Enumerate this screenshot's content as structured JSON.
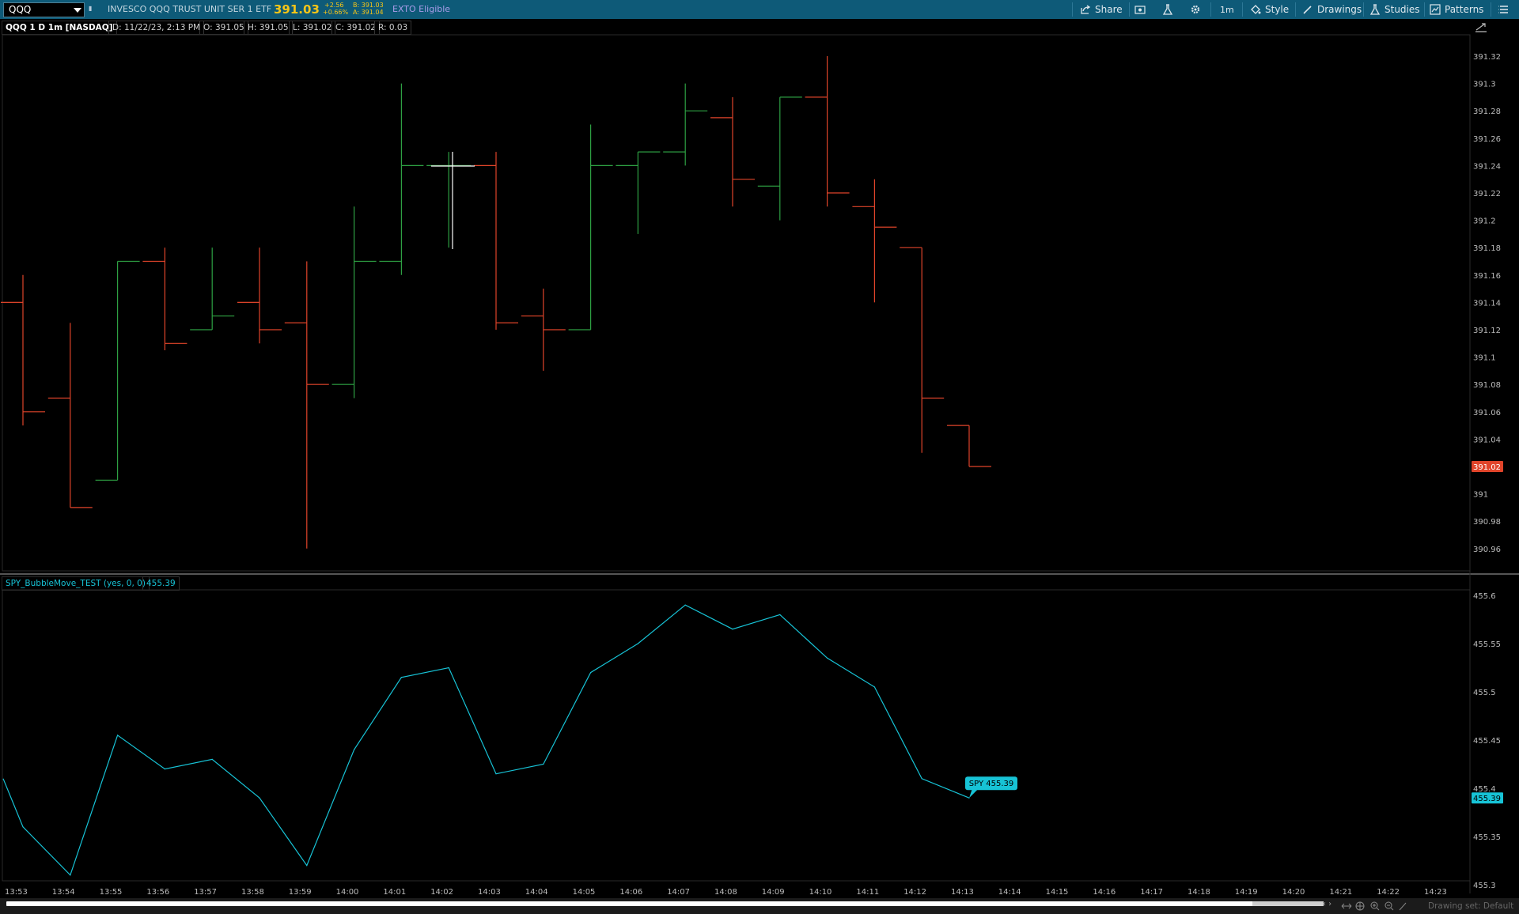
{
  "toolbar": {
    "symbol": "QQQ",
    "description": "INVESCO QQQ TRUST UNIT SER 1 ETF",
    "last_price": "391.03",
    "change": "+2.56",
    "change_pct": "+0.66%",
    "bid": "B: 391.03",
    "ask": "A: 391.04",
    "exto": "EXTO Eligible",
    "share": "Share",
    "timeframe": "1m",
    "style": "Style",
    "drawings": "Drawings",
    "studies": "Studies",
    "patterns": "Patterns",
    "colors": {
      "bar": "#0e5a78",
      "price": "#f5c518",
      "positive": "#3ec46d",
      "exto": "#9c8ee0"
    }
  },
  "header": {
    "title": "QQQ 1 D 1m [NASDAQ]",
    "date": "D: 11/22/23, 2:13 PM",
    "open": "O: 391.05",
    "high": "H: 391.05",
    "low": "L: 391.02",
    "close": "C: 391.02",
    "range": "R: 0.03"
  },
  "lower_header": {
    "study": "SPY_BubbleMove_TEST (yes, 0, 0)",
    "value": "455.39"
  },
  "bottom": {
    "drawing_set": "Drawing set: Default"
  },
  "chart_data": [
    {
      "type": "ohlc",
      "title": "QQQ 1 D 1m [NASDAQ]",
      "up_color": "#2ea043",
      "down_color": "#e0442a",
      "ylim": [
        390.95,
        391.33
      ],
      "yticks": [
        "391.32",
        "391.3",
        "391.28",
        "391.26",
        "391.24",
        "391.22",
        "391.2",
        "391.18",
        "391.16",
        "391.14",
        "391.12",
        "391.1",
        "391.08",
        "391.06",
        "391.04",
        "391",
        "390.98",
        "390.96"
      ],
      "last_price_tag": "391.02",
      "bars": [
        {
          "t": "13:53",
          "o": 391.14,
          "h": 391.16,
          "l": 391.05,
          "c": 391.06
        },
        {
          "t": "13:54",
          "o": 391.07,
          "h": 391.125,
          "l": 390.99,
          "c": 390.99
        },
        {
          "t": "13:55",
          "o": 391.01,
          "h": 391.17,
          "l": 391.01,
          "c": 391.17
        },
        {
          "t": "13:56",
          "o": 391.17,
          "h": 391.18,
          "l": 391.105,
          "c": 391.11
        },
        {
          "t": "13:57",
          "o": 391.12,
          "h": 391.18,
          "l": 391.12,
          "c": 391.13
        },
        {
          "t": "13:58",
          "o": 391.14,
          "h": 391.18,
          "l": 391.11,
          "c": 391.12
        },
        {
          "t": "13:59",
          "o": 391.125,
          "h": 391.17,
          "l": 390.96,
          "c": 391.08
        },
        {
          "t": "14:00",
          "o": 391.08,
          "h": 391.21,
          "l": 391.07,
          "c": 391.17
        },
        {
          "t": "14:01",
          "o": 391.17,
          "h": 391.3,
          "l": 391.16,
          "c": 391.24
        },
        {
          "t": "14:02",
          "o": 391.24,
          "h": 391.25,
          "l": 391.18,
          "c": 391.24
        },
        {
          "t": "14:03",
          "o": 391.24,
          "h": 391.25,
          "l": 391.12,
          "c": 391.125
        },
        {
          "t": "14:04",
          "o": 391.13,
          "h": 391.15,
          "l": 391.09,
          "c": 391.12
        },
        {
          "t": "14:05",
          "o": 391.12,
          "h": 391.27,
          "l": 391.12,
          "c": 391.24
        },
        {
          "t": "14:06",
          "o": 391.24,
          "h": 391.25,
          "l": 391.19,
          "c": 391.25
        },
        {
          "t": "14:07",
          "o": 391.25,
          "h": 391.3,
          "l": 391.24,
          "c": 391.28
        },
        {
          "t": "14:08",
          "o": 391.275,
          "h": 391.29,
          "l": 391.21,
          "c": 391.23
        },
        {
          "t": "14:09",
          "o": 391.225,
          "h": 391.29,
          "l": 391.2,
          "c": 391.29
        },
        {
          "t": "14:10",
          "o": 391.29,
          "h": 391.32,
          "l": 391.21,
          "c": 391.22
        },
        {
          "t": "14:11",
          "o": 391.21,
          "h": 391.23,
          "l": 391.14,
          "c": 391.195
        },
        {
          "t": "14:12",
          "o": 391.18,
          "h": 391.18,
          "l": 391.03,
          "c": 391.07
        },
        {
          "t": "14:13",
          "o": 391.05,
          "h": 391.05,
          "l": 391.02,
          "c": 391.02
        }
      ]
    },
    {
      "type": "line",
      "title": "SPY_BubbleMove_TEST (yes, 0, 0)",
      "color": "#17c3d6",
      "ylim": [
        455.3,
        455.6
      ],
      "yticks": [
        "455.6",
        "455.55",
        "455.5",
        "455.45",
        "455.4",
        "455.35",
        "455.3"
      ],
      "bubble_label": "SPY 455.39",
      "value_tag": "455.39",
      "x": [
        "13:53",
        "13:54",
        "13:55",
        "13:56",
        "13:57",
        "13:58",
        "13:59",
        "14:00",
        "14:01",
        "14:02",
        "14:03",
        "14:04",
        "14:05",
        "14:06",
        "14:07",
        "14:08",
        "14:09",
        "14:10",
        "14:11",
        "14:12",
        "14:13"
      ],
      "values": [
        455.36,
        455.31,
        455.455,
        455.42,
        455.43,
        455.39,
        455.32,
        455.44,
        455.515,
        455.525,
        455.415,
        455.425,
        455.52,
        455.55,
        455.59,
        455.565,
        455.58,
        455.535,
        455.505,
        455.41,
        455.39
      ],
      "leading_value": 455.41
    }
  ],
  "time_axis": [
    "13:53",
    "13:54",
    "13:55",
    "13:56",
    "13:57",
    "13:58",
    "13:59",
    "14:00",
    "14:01",
    "14:02",
    "14:03",
    "14:04",
    "14:05",
    "14:06",
    "14:07",
    "14:08",
    "14:09",
    "14:10",
    "14:11",
    "14:12",
    "14:13",
    "14:14",
    "14:15",
    "14:16",
    "14:17",
    "14:18",
    "14:19",
    "14:20",
    "14:21",
    "14:22",
    "14:23"
  ]
}
